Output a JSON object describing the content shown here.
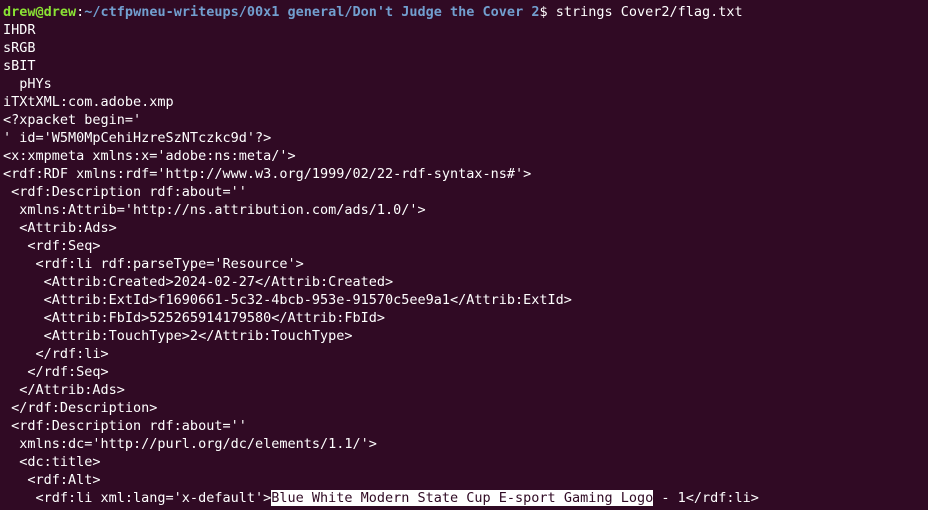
{
  "prompt": {
    "user_host": "drew@drew",
    "separator": ":",
    "cwd": "~/ctfpwneu-writeups/00x1 general/Don't Judge the Cover 2",
    "symbol": "$ ",
    "command": "strings Cover2/flag.txt"
  },
  "output_lines": [
    "IHDR",
    "sRGB",
    "sBIT",
    "  pHYs",
    "iTXtXML:com.adobe.xmp",
    "<?xpacket begin='",
    "' id='W5M0MpCehiHzreSzNTczkc9d'?>",
    "<x:xmpmeta xmlns:x='adobe:ns:meta/'>",
    "<rdf:RDF xmlns:rdf='http://www.w3.org/1999/02/22-rdf-syntax-ns#'>",
    " <rdf:Description rdf:about=''",
    "  xmlns:Attrib='http://ns.attribution.com/ads/1.0/'>",
    "  <Attrib:Ads>",
    "   <rdf:Seq>",
    "    <rdf:li rdf:parseType='Resource'>",
    "     <Attrib:Created>2024-02-27</Attrib:Created>",
    "     <Attrib:ExtId>f1690661-5c32-4bcb-953e-91570c5ee9a1</Attrib:ExtId>",
    "     <Attrib:FbId>525265914179580</Attrib:FbId>",
    "     <Attrib:TouchType>2</Attrib:TouchType>",
    "    </rdf:li>",
    "   </rdf:Seq>",
    "  </Attrib:Ads>",
    " </rdf:Description>",
    " <rdf:Description rdf:about=''",
    "  xmlns:dc='http://purl.org/dc/elements/1.1/'>",
    "  <dc:title>",
    "   <rdf:Alt>"
  ],
  "last_line": {
    "before": "    <rdf:li xml:lang='x-default'>",
    "selected": "Blue White Modern State Cup E-sport Gaming Logo",
    "after": " - 1</rdf:li>"
  },
  "colors": {
    "background": "#300a24",
    "text": "#ffffff",
    "user_host": "#8ae234",
    "path": "#729fcf"
  }
}
